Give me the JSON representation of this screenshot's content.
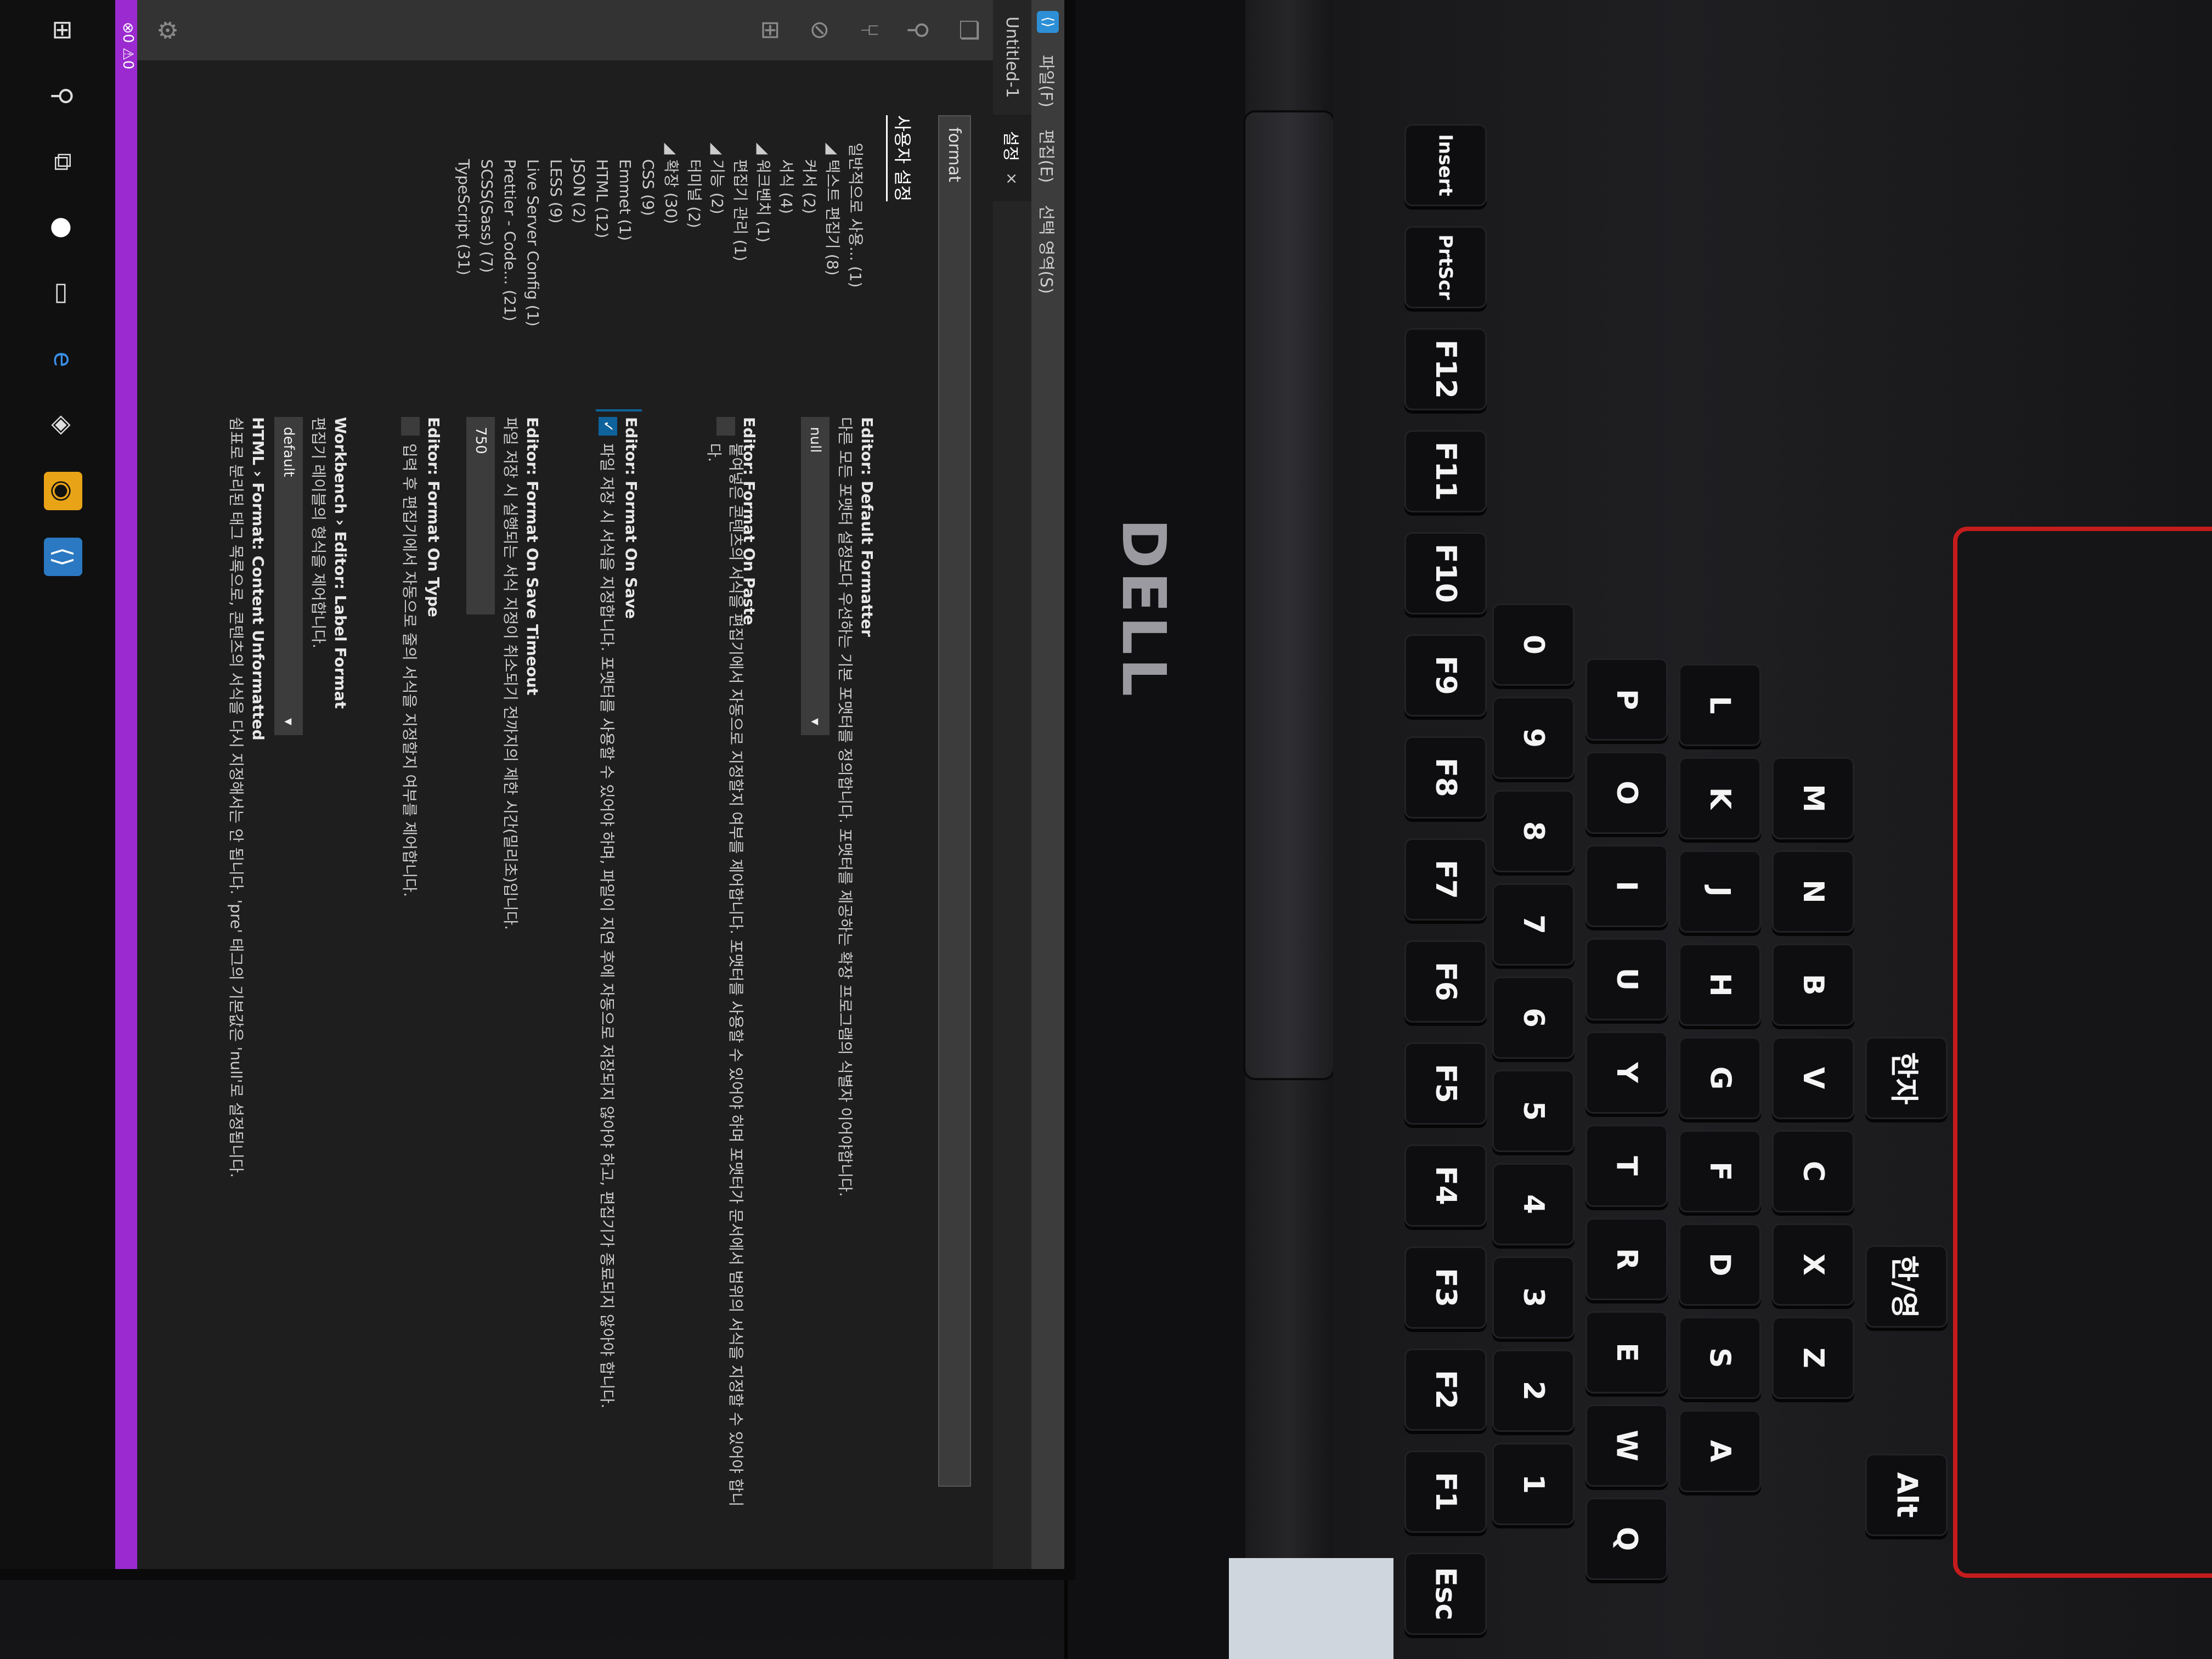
{
  "window": {
    "menu": [
      "파일(F)",
      "편집(E)",
      "선택 영역(S)"
    ],
    "tabs": [
      {
        "label": "Untitled-1",
        "active": false
      },
      {
        "label": "설정",
        "active": true
      }
    ]
  },
  "settings": {
    "search_value": "format",
    "heading": "사용자 설정",
    "toc": [
      {
        "label": "일반적으로 사용... (1)",
        "level": 1
      },
      {
        "label": "텍스트 편집기 (8)",
        "level": 1
      },
      {
        "label": "커서 (2)",
        "level": 2
      },
      {
        "label": "서식 (4)",
        "level": 2
      },
      {
        "label": "워크벤치 (1)",
        "level": 1
      },
      {
        "label": "편집기 관리 (1)",
        "level": 2
      },
      {
        "label": "기능 (2)",
        "level": 1
      },
      {
        "label": "터미널 (2)",
        "level": 2
      },
      {
        "label": "확장 (30)",
        "level": 1
      },
      {
        "label": "CSS (9)",
        "level": 2
      },
      {
        "label": "Emmet (1)",
        "level": 2
      },
      {
        "label": "HTML (12)",
        "level": 2
      },
      {
        "label": "JSON (2)",
        "level": 2
      },
      {
        "label": "LESS (9)",
        "level": 2
      },
      {
        "label": "Live Server Config (1)",
        "level": 2
      },
      {
        "label": "Prettier - Code... (21)",
        "level": 2
      },
      {
        "label": "SCSS(Sass) (7)",
        "level": 2
      },
      {
        "label": "TypeScript (31)",
        "level": 2
      }
    ],
    "items": [
      {
        "title": "Editor: Default Formatter",
        "desc": "다른 모든 포맷터 설정보다 우선하는 기본 포맷터를 정의합니다. 포맷터를 제공하는 확장 프로그램의 식별자 이어야합니다.",
        "control": "select",
        "value": "null"
      },
      {
        "title": "Editor: Format On Paste",
        "desc": "붙여넣은 콘텐츠의 서식을 편집기에서 자동으로 지정할지 여부를 제어합니다. 포맷터를 사용할 수 있어야 하며 포맷터가 문서에서 범위의 서식을 지정할 수 있어야 합니다.",
        "control": "checkbox",
        "checked": false
      },
      {
        "title": "Editor: Format On Save",
        "desc": "파일 저장 시 서식을 지정합니다. 포맷터를 사용할 수 있어야 하며, 파일이 지연 후에 자동으로 저장되지 않아야 하고, 편집기가 종료되지 않아야 합니다.",
        "control": "checkbox",
        "checked": true
      },
      {
        "title": "Editor: Format On Save Timeout",
        "desc": "파일 저장 시 실행되는 서식 지정이 취소되기 전까지의 제한 시간(밀리초)입니다.",
        "control": "input",
        "value": "750"
      },
      {
        "title": "Editor: Format On Type",
        "desc": "입력 후 편집기에서 자동으로 줄의 서식을 지정할지 여부를 제어합니다.",
        "control": "checkbox",
        "checked": false
      },
      {
        "title": "Workbench › Editor: Label Format",
        "desc": "편집기 레이블의 형식을 제어합니다.",
        "control": "select",
        "value": "default"
      },
      {
        "title": "HTML › Format: Content Unformatted",
        "desc": "쉼표로 분리된 태그 목록으로, 콘텐츠의 서식을 다시 지정해서는 안 됩니다. 'pre' 태그의 기본값은 'null'로 설정됩니다.",
        "control": "none"
      }
    ]
  },
  "laptop": {
    "brand": "DELL",
    "keys": [
      {
        "label": "Esc"
      },
      {
        "label": "F1"
      },
      {
        "label": "F2"
      },
      {
        "label": "F3"
      },
      {
        "label": "F4"
      },
      {
        "label": "F5"
      },
      {
        "label": "F6"
      },
      {
        "label": "F7"
      },
      {
        "label": "F8"
      },
      {
        "label": "F9"
      },
      {
        "label": "F10"
      },
      {
        "label": "F11"
      },
      {
        "label": "F12"
      },
      {
        "label": "PrtScr"
      },
      {
        "label": "Insert"
      },
      {
        "label": "1"
      },
      {
        "label": "2"
      },
      {
        "label": "3"
      },
      {
        "label": "4"
      },
      {
        "label": "5"
      },
      {
        "label": "6"
      },
      {
        "label": "7"
      },
      {
        "label": "8"
      },
      {
        "label": "9"
      },
      {
        "label": "0"
      },
      {
        "label": "Q"
      },
      {
        "label": "W"
      },
      {
        "label": "E"
      },
      {
        "label": "R"
      },
      {
        "label": "T"
      },
      {
        "label": "Y"
      },
      {
        "label": "U"
      },
      {
        "label": "I"
      },
      {
        "label": "O"
      },
      {
        "label": "P"
      },
      {
        "label": "A"
      },
      {
        "label": "S"
      },
      {
        "label": "D"
      },
      {
        "label": "F"
      },
      {
        "label": "G"
      },
      {
        "label": "H"
      },
      {
        "label": "J"
      },
      {
        "label": "K"
      },
      {
        "label": "L"
      },
      {
        "label": "Z"
      },
      {
        "label": "X"
      },
      {
        "label": "C"
      },
      {
        "label": "V"
      },
      {
        "label": "B"
      },
      {
        "label": "N"
      },
      {
        "label": "M"
      },
      {
        "label": "Alt"
      },
      {
        "label": "한/영"
      },
      {
        "label": "한자"
      }
    ]
  },
  "colors": {
    "editor_bg": "#1e1e1e",
    "status_bar": "#9b2bd0",
    "touchpad_trim": "#c41c1c",
    "checkbox_on": "#0e639c"
  }
}
